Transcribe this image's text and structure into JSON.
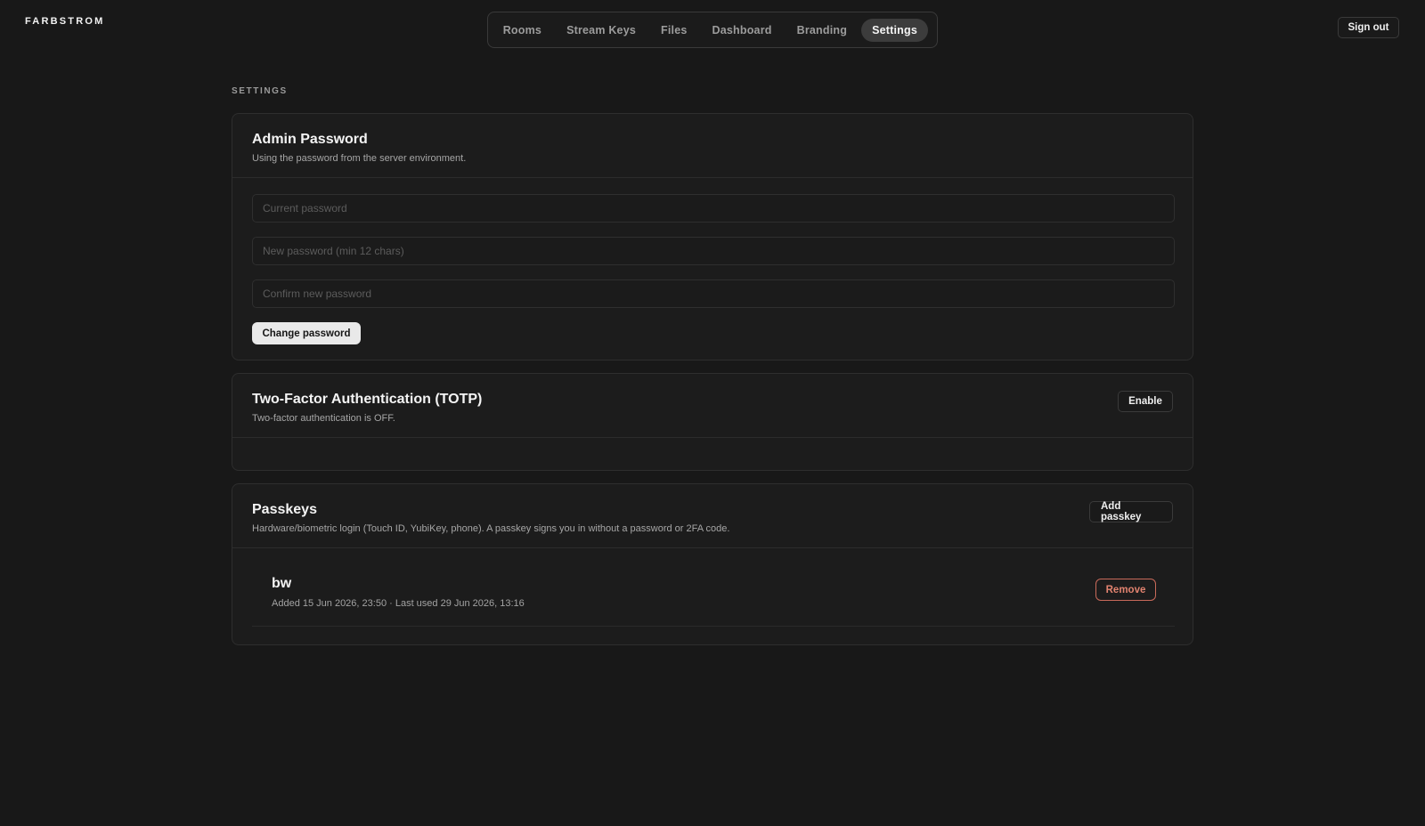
{
  "app": {
    "brand": "FARBSTROM"
  },
  "nav": {
    "items": [
      {
        "label": "Rooms"
      },
      {
        "label": "Stream Keys"
      },
      {
        "label": "Files"
      },
      {
        "label": "Dashboard"
      },
      {
        "label": "Branding"
      },
      {
        "label": "Settings",
        "active": true
      }
    ]
  },
  "header": {
    "signout_label": "Sign out"
  },
  "page": {
    "section_label": "SETTINGS"
  },
  "admin_password": {
    "title": "Admin Password",
    "subtitle": "Using the password from the server environment.",
    "current_placeholder": "Current password",
    "new_placeholder": "New password (min 12 chars)",
    "confirm_placeholder": "Confirm new password",
    "submit_label": "Change password"
  },
  "two_factor": {
    "title": "Two-Factor Authentication (TOTP)",
    "subtitle": "Two-factor authentication is OFF.",
    "enable_label": "Enable"
  },
  "passkeys": {
    "title": "Passkeys",
    "subtitle": "Hardware/biometric login (Touch ID, YubiKey, phone). A passkey signs you in without a password or 2FA code.",
    "add_label": "Add passkey",
    "items": [
      {
        "name": "bw",
        "meta": "Added 15 Jun 2026, 23:50 · Last used 29 Jun 2026, 13:16",
        "remove_label": "Remove"
      }
    ]
  },
  "colors": {
    "background": "#181818",
    "card": "#1c1c1c",
    "danger": "#e0826f"
  }
}
